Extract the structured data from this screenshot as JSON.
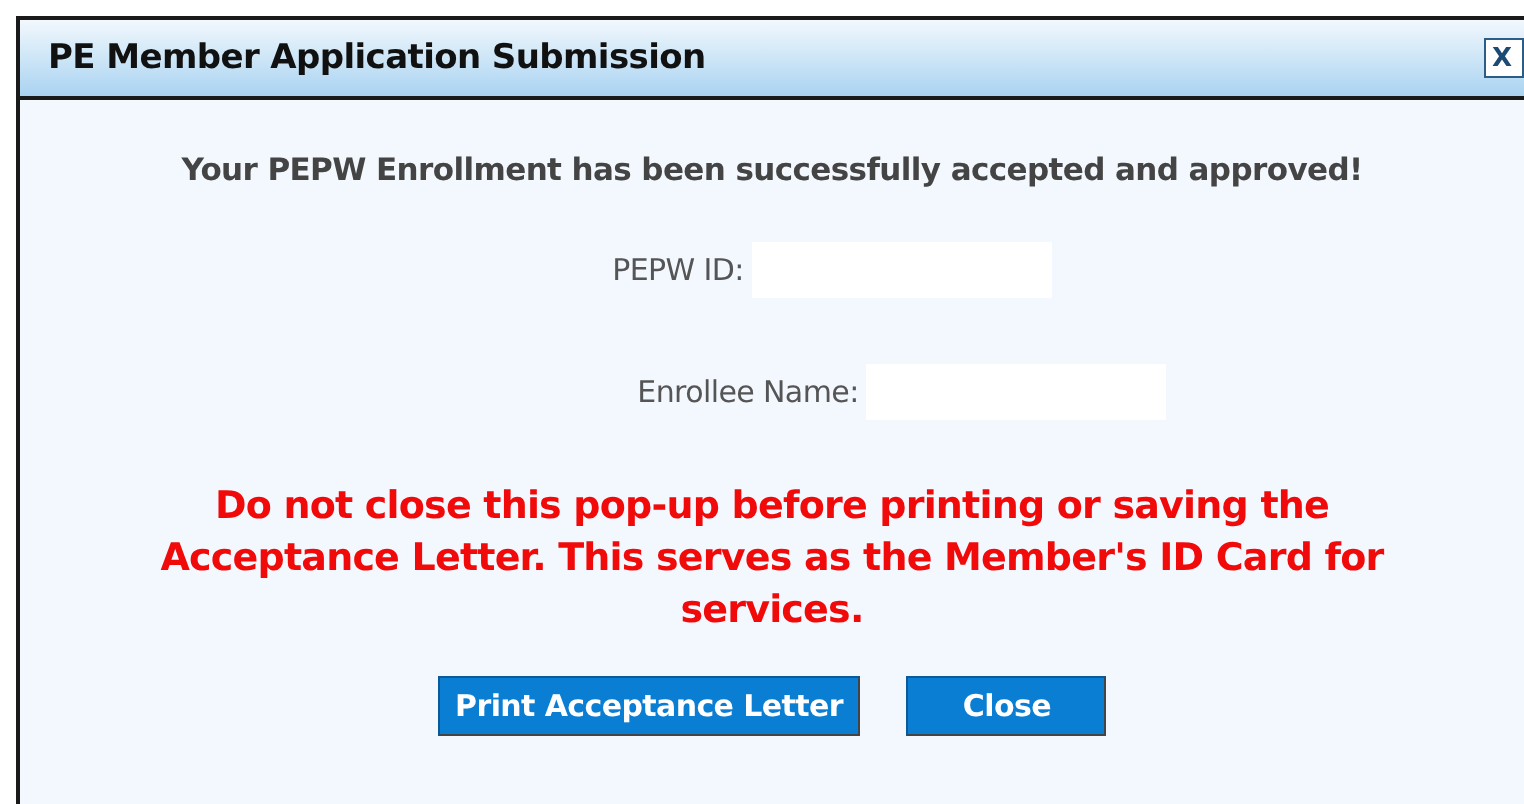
{
  "window": {
    "title": "PE Member Application Submission",
    "close_label": "X"
  },
  "message": "Your PEPW Enrollment has been successfully accepted and approved!",
  "fields": [
    {
      "label": "PEPW ID:"
    },
    {
      "label": "Enrollee Name:"
    }
  ],
  "warning": "Do not close this pop-up before printing or saving the Acceptance Letter. This serves as the Member's ID Card for services.",
  "buttons": [
    "Print Acceptance Letter",
    "Close"
  ]
}
